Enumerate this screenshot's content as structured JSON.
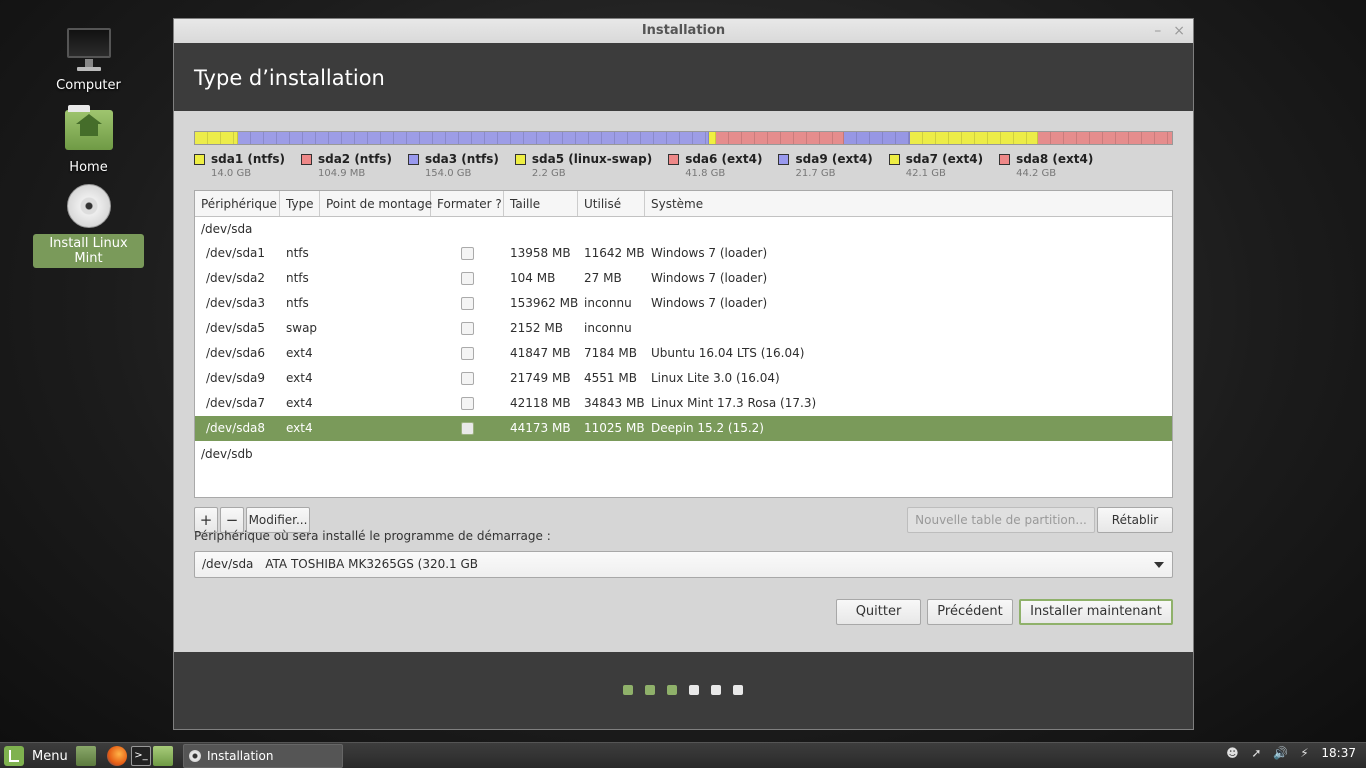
{
  "desktop": {
    "icons": [
      {
        "label": "Computer"
      },
      {
        "label": "Home"
      },
      {
        "label": "Install Linux Mint"
      }
    ]
  },
  "window": {
    "title": "Installation",
    "controls": {
      "minimize": "–",
      "close": "×"
    },
    "header": "Type d’installation"
  },
  "partition_bar": {
    "colors": {
      "ntfs": "#f0f060",
      "ntfs_system": "#ee8c8c",
      "ntfs_blue": "#9d9de8",
      "swap": "#f3f34a",
      "ext4_red": "#e58d8d",
      "ext4_blue": "#9797e4",
      "ext4_yellow": "#f0f040"
    },
    "legend": [
      {
        "name": "sda1 (ntfs)",
        "size": "14.0 GB",
        "color": "#eeee44"
      },
      {
        "name": "sda2 (ntfs)",
        "size": "104.9 MB",
        "color": "#ee8888"
      },
      {
        "name": "sda3 (ntfs)",
        "size": "154.0 GB",
        "color": "#9999ee"
      },
      {
        "name": "sda5 (linux-swap)",
        "size": "2.2 GB",
        "color": "#eeee44"
      },
      {
        "name": "sda6 (ext4)",
        "size": "41.8 GB",
        "color": "#ee8888"
      },
      {
        "name": "sda9 (ext4)",
        "size": "21.7 GB",
        "color": "#9999ee"
      },
      {
        "name": "sda7 (ext4)",
        "size": "42.1 GB",
        "color": "#eeee44"
      },
      {
        "name": "sda8 (ext4)",
        "size": "44.2 GB",
        "color": "#ee8888"
      }
    ]
  },
  "table": {
    "headers": [
      "Périphérique",
      "Type",
      "Point de montage",
      "Formater ?",
      "Taille",
      "Utilisé",
      "Système"
    ],
    "groups": [
      "/dev/sda",
      "/dev/sdb"
    ],
    "rows": [
      {
        "device": "/dev/sda1",
        "type": "ntfs",
        "mount": "",
        "size": "13958 MB",
        "used": "11642 MB",
        "system": "Windows 7 (loader)"
      },
      {
        "device": "/dev/sda2",
        "type": "ntfs",
        "mount": "",
        "size": "104 MB",
        "used": "27 MB",
        "system": "Windows 7 (loader)"
      },
      {
        "device": "/dev/sda3",
        "type": "ntfs",
        "mount": "",
        "size": "153962 MB",
        "used": "inconnu",
        "system": "Windows 7 (loader)"
      },
      {
        "device": "/dev/sda5",
        "type": "swap",
        "mount": "",
        "size": "2152 MB",
        "used": "inconnu",
        "system": ""
      },
      {
        "device": "/dev/sda6",
        "type": "ext4",
        "mount": "",
        "size": "41847 MB",
        "used": "7184 MB",
        "system": "Ubuntu 16.04 LTS (16.04)"
      },
      {
        "device": "/dev/sda9",
        "type": "ext4",
        "mount": "",
        "size": "21749 MB",
        "used": "4551 MB",
        "system": "Linux Lite 3.0 (16.04)"
      },
      {
        "device": "/dev/sda7",
        "type": "ext4",
        "mount": "",
        "size": "42118 MB",
        "used": "34843 MB",
        "system": "Linux Mint 17.3 Rosa (17.3)"
      },
      {
        "device": "/dev/sda8",
        "type": "ext4",
        "mount": "",
        "size": "44173 MB",
        "used": "11025 MB",
        "system": "Deepin 15.2  (15.2)"
      }
    ],
    "selected_index": 7
  },
  "actions": {
    "add": "+",
    "remove": "−",
    "modify": "Modifier...",
    "new_table": "Nouvelle table de partition...",
    "revert": "Rétablir"
  },
  "bootloader": {
    "label": "Périphérique où sera installé le programme de démarrage :",
    "device": "/dev/sda",
    "description": "ATA TOSHIBA MK3265GS (320.1 GB"
  },
  "nav": {
    "quit": "Quitter",
    "back": "Précédent",
    "install": "Installer maintenant"
  },
  "progress": {
    "total_steps": 6,
    "completed_steps": 3
  },
  "taskbar": {
    "menu_label": "Menu",
    "task_label": "Installation",
    "clock": "18:37"
  }
}
